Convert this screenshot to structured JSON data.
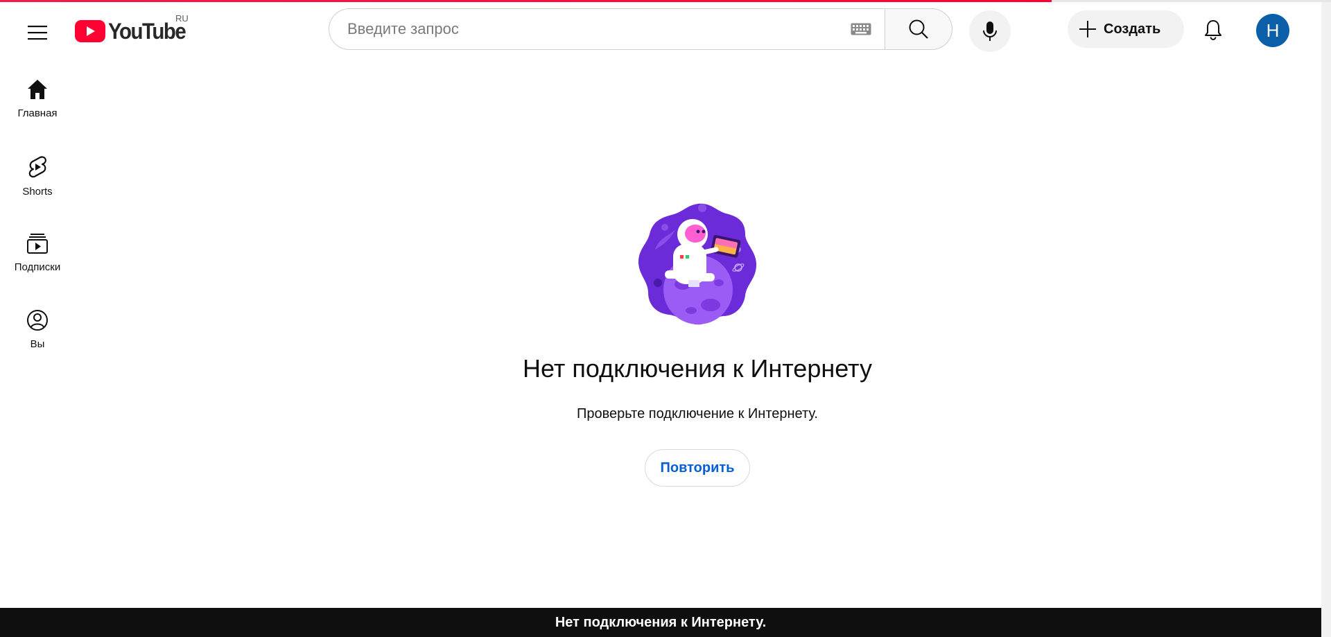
{
  "page": {
    "progress_percent": 79
  },
  "header": {
    "logo_text": "YouTube",
    "country_code": "RU",
    "search_placeholder": "Введите запрос",
    "create_label": "Создать",
    "avatar_letter": "Н"
  },
  "guide": {
    "items": [
      {
        "label": "Главная",
        "icon": "home-icon"
      },
      {
        "label": "Shorts",
        "icon": "shorts-icon"
      },
      {
        "label": "Подписки",
        "icon": "subscriptions-icon"
      },
      {
        "label": "Вы",
        "icon": "you-icon"
      }
    ]
  },
  "error": {
    "title": "Нет подключения к Интернету",
    "message": "Проверьте подключение к Интернету.",
    "retry_label": "Повторить"
  },
  "toast": {
    "text": "Нет подключения к Интернету."
  },
  "colors": {
    "brand_red": "#ff0033",
    "link_blue": "#065fd4",
    "avatar_bg": "#0b5ea8"
  }
}
